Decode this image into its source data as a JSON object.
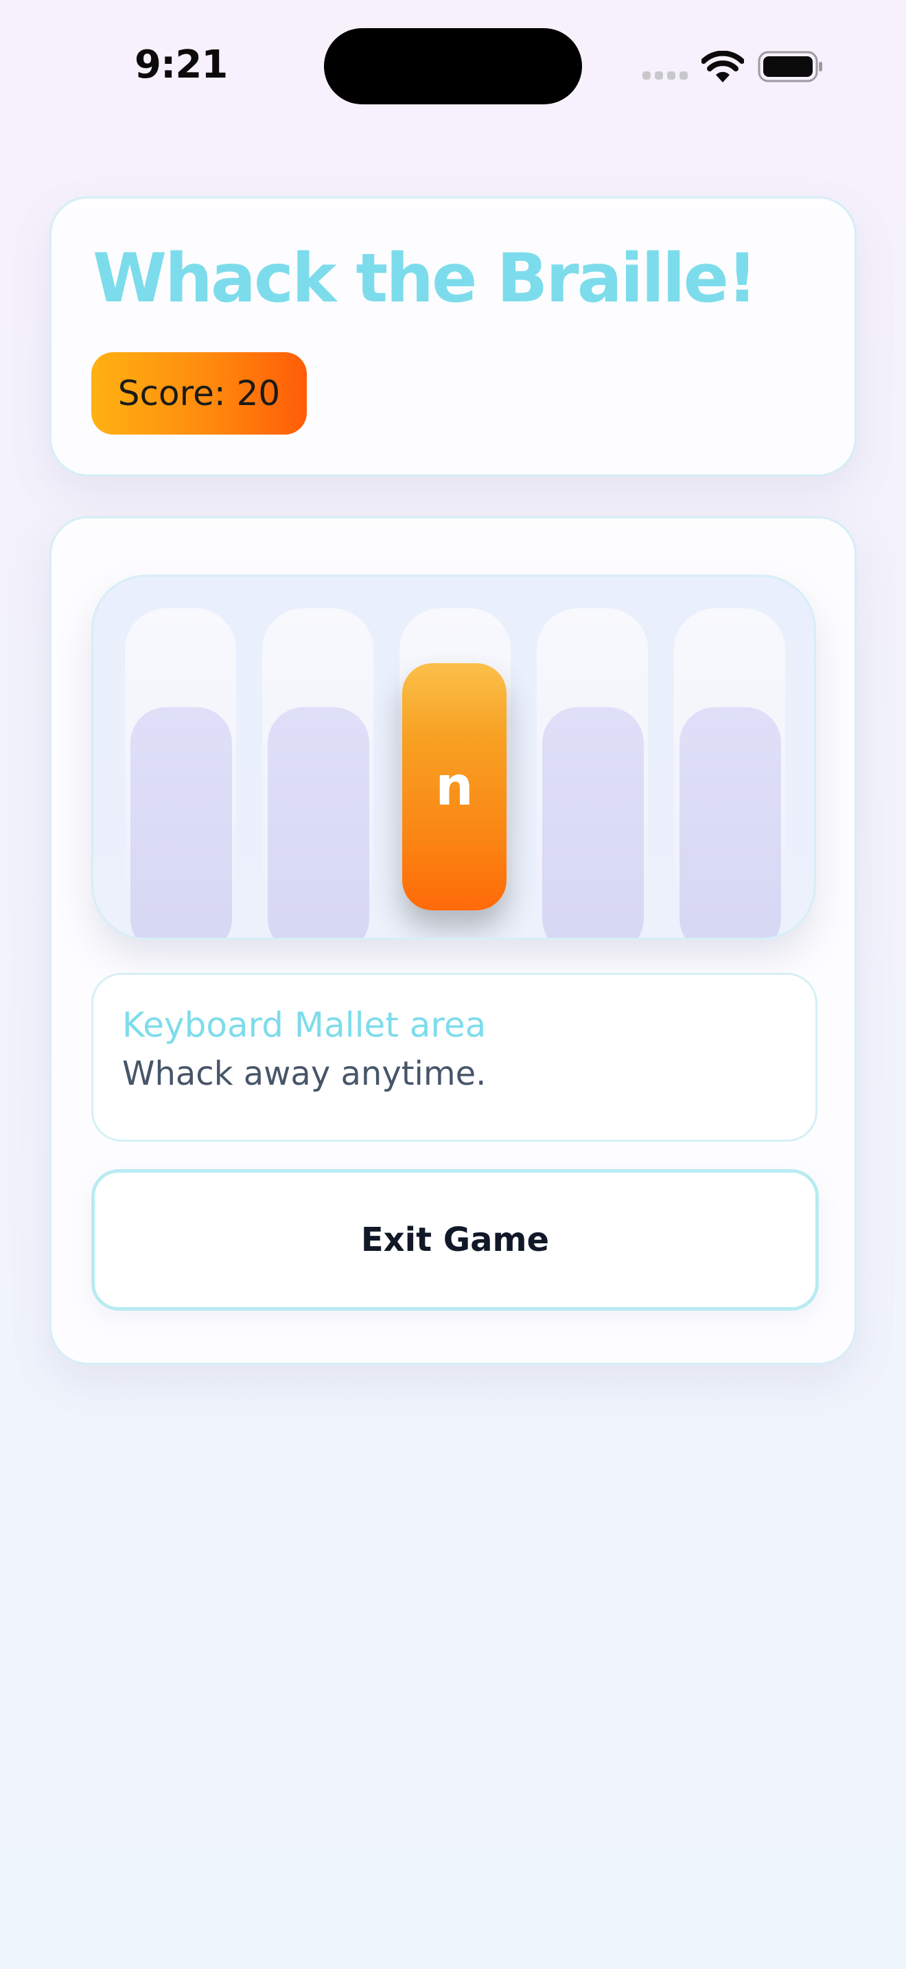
{
  "status_bar": {
    "time": "9:21"
  },
  "header": {
    "title": "Whack the Braille!",
    "score_label": "Score: 20"
  },
  "board": {
    "active_mole_letter": "n",
    "holes": [
      "hidden",
      "hidden",
      "up",
      "hidden",
      "hidden"
    ]
  },
  "info_panel": {
    "title": "Keyboard Mallet area",
    "text": "Whack away anytime."
  },
  "actions": {
    "exit_label": "Exit Game"
  },
  "colors": {
    "title": "#7ddceb",
    "score_gradient": [
      "#ffb112",
      "#ff5c07"
    ],
    "mole_gradient": [
      "#fac04a",
      "#ff6a08"
    ],
    "hidden_mole": "#d8d9f4"
  }
}
